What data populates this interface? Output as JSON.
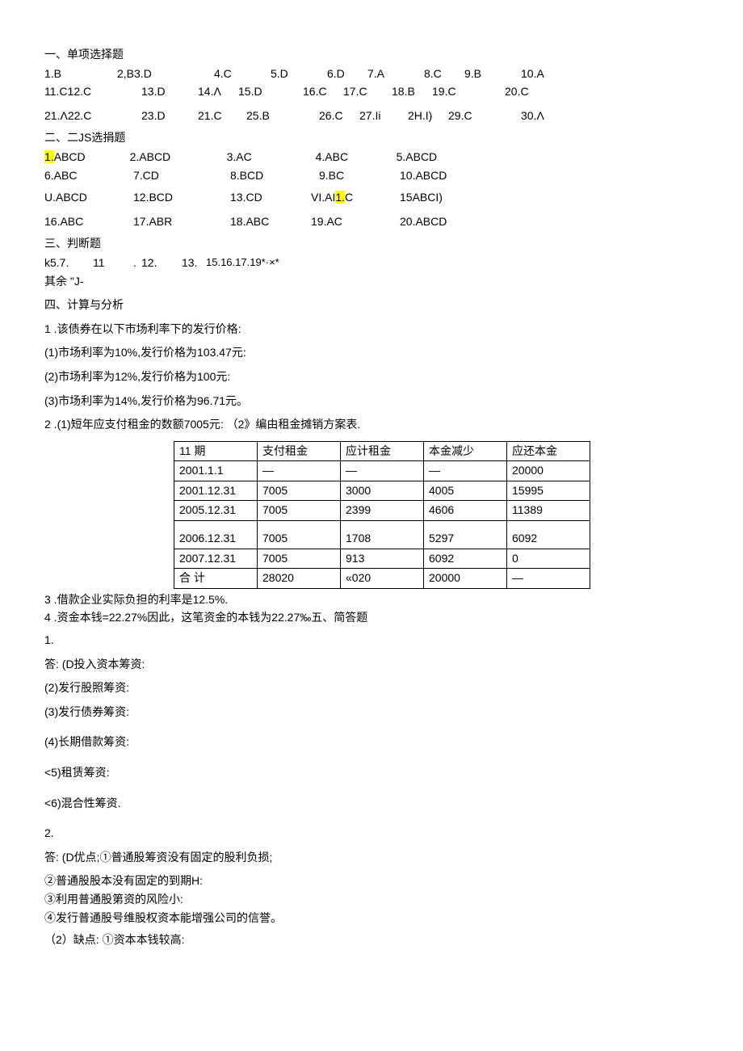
{
  "section1": {
    "title": "一、单项选择题",
    "row1": [
      "1.B",
      "2,B3.D",
      "4.C",
      "5.D",
      "6.D",
      "7.A",
      "8.C",
      "9.B",
      "10.A"
    ],
    "row2": [
      "11.C12.C",
      "13.D",
      "14.Λ",
      "15.D",
      "16.C",
      "17.C",
      "18.B",
      "19.C",
      "20.C"
    ],
    "row3": [
      "21.Λ22.C",
      "23.D",
      "21.C",
      "25.B",
      "26.C",
      "27.Ii",
      "2H.I)",
      "29.C",
      "30.Λ"
    ]
  },
  "section2": {
    "title": "二、二JS选捐题",
    "row1": {
      "c1a": "1.",
      "c1b": "ABCD",
      "c2": "2.ABCD",
      "c3": "3.AC",
      "c4": "4.ABC",
      "c5": "5.ABCD"
    },
    "row2": [
      "6.ABC",
      "7.CD",
      "8.BCD",
      "9.BC",
      "10.ABCD"
    ],
    "row3": {
      "c1": "U.ABCD",
      "c2": "12.BCD",
      "c3": "13.CD",
      "c4a": "VI.AI",
      "c4b": "1.",
      "c4c": "C",
      "c5": "15ABCI)"
    },
    "row4": [
      "16.ABC",
      "17.ABR",
      "18.ABC",
      "19.AC",
      "20.ABCD"
    ]
  },
  "section3": {
    "title": "三、判断题",
    "line1_a": "k5.7.",
    "line1_b": "11",
    "line1_c": ".",
    "line1_d": "12.",
    "line1_e": "13.",
    "line1_f": "15.16.17.19*·×*",
    "line2": "其余 \"J-"
  },
  "section4": {
    "title": "四、计算与分析",
    "q1": "1 .该债券在以下市场利率下的发行价格:",
    "q1_1": "(1)市场利率为10%,发行价格为103.47元:",
    "q1_2": "(2)市场利率为12%,发行价格为100元:",
    "q1_3": "(3)市场利率为14%,发行价格为96.71元。",
    "q2": "2 .(1)短年应支付租金的数额7005元: （2》编由租金摊销方案表.",
    "table": {
      "head": [
        "11        期",
        "支付租金",
        "应计租金",
        "本金减少",
        "应还本金"
      ],
      "rows": [
        [
          "2001.1.1",
          "—",
          "—",
          "—",
          "20000"
        ],
        [
          "2001.12.31",
          "7005",
          "3000",
          "4005",
          "15995"
        ],
        [
          "2005.12.31",
          "7005",
          "2399",
          "4606",
          "11389"
        ],
        [
          "2006.12.31",
          "7005",
          "1708",
          "5297",
          "6092"
        ],
        [
          "2007.12.31",
          "7005",
          "913",
          "6092",
          "0"
        ],
        [
          "合        计",
          "28020",
          "«020",
          "20000",
          "—"
        ]
      ]
    },
    "q3": "3 .借款企业实际负担的利率是12.5%.",
    "q4": "4 .资金本钱=22.27%因此，这笔资金的本钱为22.27‰五、简答题",
    "a1_num": "1.",
    "a1_0": "答:   (D投入资本筹资:",
    "a1_2": "(2)发行股照筹资:",
    "a1_3": "(3)发行债券筹资:",
    "a1_4": "(4)长期借款筹资:",
    "a1_5": "<5)租赁筹资:",
    "a1_6": "<6)混合性筹资.",
    "a2_num": "2.",
    "a2_0": "答:   (D优点;①普通股筹资没有固定的股利负损;",
    "a2_2": "②普通股股本没有固定的到期H:",
    "a2_3": "③利用普通股第资的风险小:",
    "a2_4": "④发行普通股号维股权资本能增强公司的信誉。",
    "a2_5": "（2）缺点:  ①资本本钱较高:"
  }
}
